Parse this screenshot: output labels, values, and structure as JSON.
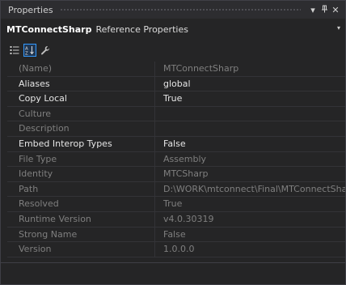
{
  "window": {
    "title": "Properties",
    "pin_glyph": "↕",
    "close_glyph": "✕",
    "dropdown_glyph": "▾"
  },
  "object": {
    "name": "MTConnectSharp",
    "type": "Reference Properties",
    "dropdown_glyph": "▾"
  },
  "toolbar": {
    "buttons": [
      {
        "icon": "categorized-icon",
        "active": false
      },
      {
        "icon": "alphabetical-sort-icon",
        "active": true
      },
      {
        "icon": "wrench-icon",
        "active": false
      }
    ]
  },
  "properties": [
    {
      "name": "(Name)",
      "value": "MTConnectSharp",
      "readonly": true
    },
    {
      "name": "Aliases",
      "value": "global",
      "readonly": false
    },
    {
      "name": "Copy Local",
      "value": "True",
      "readonly": false
    },
    {
      "name": "Culture",
      "value": "",
      "readonly": true
    },
    {
      "name": "Description",
      "value": "",
      "readonly": true
    },
    {
      "name": "Embed Interop Types",
      "value": "False",
      "readonly": false
    },
    {
      "name": "File Type",
      "value": "Assembly",
      "readonly": true
    },
    {
      "name": "Identity",
      "value": "MTCSharp",
      "readonly": true
    },
    {
      "name": "Path",
      "value": "D:\\WORK\\mtconnect\\Final\\MTConnectSharp-",
      "readonly": true
    },
    {
      "name": "Resolved",
      "value": "True",
      "readonly": true
    },
    {
      "name": "Runtime Version",
      "value": "v4.0.30319",
      "readonly": true
    },
    {
      "name": "Strong Name",
      "value": "False",
      "readonly": true
    },
    {
      "name": "Version",
      "value": "1.0.0.0",
      "readonly": true
    }
  ],
  "colors": {
    "background": "#252526",
    "readonly_text": "#7f7f7f",
    "editable_text": "#e6e6e6",
    "accent": "#3399ff"
  }
}
